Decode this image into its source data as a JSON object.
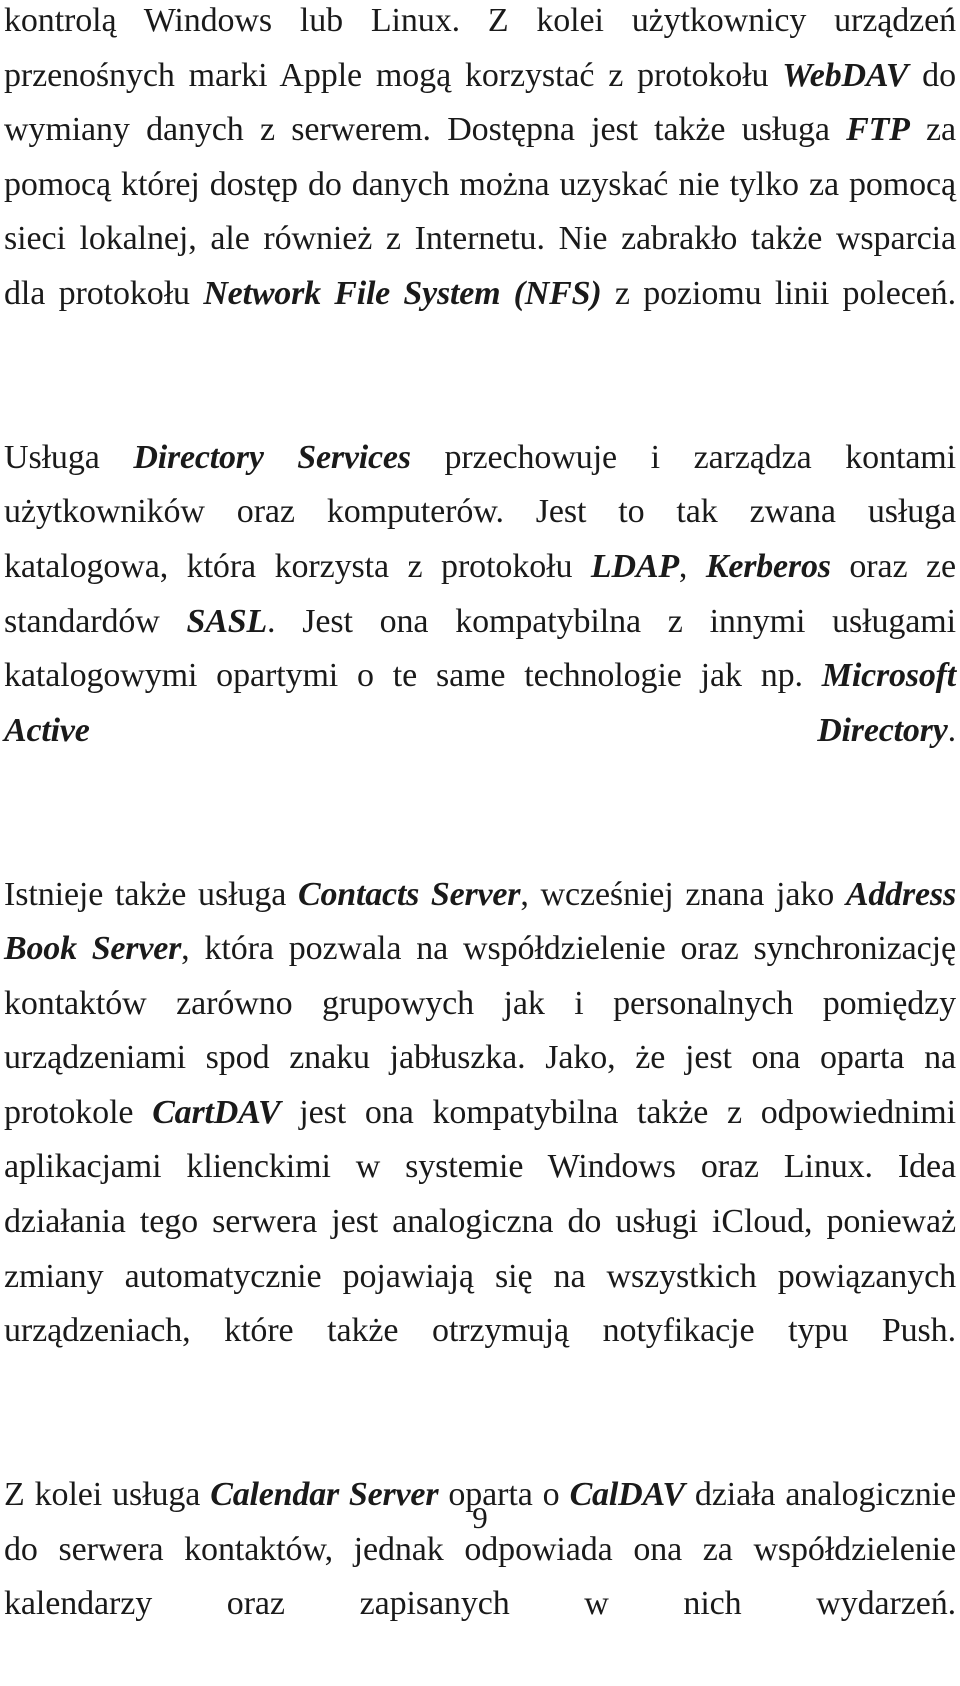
{
  "document": {
    "language": "pl",
    "page_number": "9",
    "text_color": "#1a1a1a",
    "background_color": "#ffffff",
    "paragraphs": [
      {
        "id": "paragraph-file-sharing",
        "runs": [
          {
            "text": "kontrolą Windows lub Linux. Z kolei użytkownicy urządzeń przenośnych marki Apple mogą korzystać z protokołu ",
            "emphasis": false
          },
          {
            "text": "WebDAV",
            "emphasis": true
          },
          {
            "text": " do wymiany danych z serwerem. Dostępna jest także usługa ",
            "emphasis": false
          },
          {
            "text": "FTP",
            "emphasis": true
          },
          {
            "text": " za pomocą której dostęp do danych można uzyskać nie tylko za pomocą sieci lokalnej, ale również z Internetu. Nie zabrakło także wsparcia dla protokołu ",
            "emphasis": false
          },
          {
            "text": "Network File System (NFS)",
            "emphasis": true
          },
          {
            "text": " z poziomu linii poleceń.",
            "emphasis": false
          }
        ]
      },
      {
        "id": "paragraph-directory-services",
        "runs": [
          {
            "text": "Usługa ",
            "emphasis": false
          },
          {
            "text": "Directory Services",
            "emphasis": true
          },
          {
            "text": " przechowuje i zarządza kontami użytkowników oraz komputerów. Jest to tak zwana usługa katalogowa, która korzysta z protokołu ",
            "emphasis": false
          },
          {
            "text": "LDAP",
            "emphasis": true
          },
          {
            "text": ", ",
            "emphasis": false
          },
          {
            "text": "Kerberos",
            "emphasis": true
          },
          {
            "text": " oraz ze standardów ",
            "emphasis": false
          },
          {
            "text": "SASL",
            "emphasis": true
          },
          {
            "text": ". Jest ona kompatybilna z innymi usługami katalogowymi opartymi o te same technologie jak np. ",
            "emphasis": false
          },
          {
            "text": "Microsoft Active Directory",
            "emphasis": true
          },
          {
            "text": ".",
            "emphasis": false
          }
        ]
      },
      {
        "id": "paragraph-contacts-server",
        "runs": [
          {
            "text": "Istnieje także usługa ",
            "emphasis": false
          },
          {
            "text": "Contacts Server",
            "emphasis": true
          },
          {
            "text": ", wcześniej znana jako ",
            "emphasis": false
          },
          {
            "text": "Address Book Server",
            "emphasis": true
          },
          {
            "text": ", która pozwala na współdzielenie oraz synchronizację kontaktów zarówno grupowych jak i personalnych pomiędzy urządzeniami spod znaku jabłuszka. Jako, że jest ona oparta na protokole ",
            "emphasis": false
          },
          {
            "text": "CartDAV",
            "emphasis": true
          },
          {
            "text": " jest ona kompatybilna także z odpowiednimi aplikacjami klienckimi w systemie Windows oraz Linux. Idea działania tego serwera jest analogiczna do usługi iCloud, ponieważ zmiany automatycznie pojawiają się na wszystkich powiązanych urządzeniach, które także otrzymują notyfikacje typu Push.",
            "emphasis": false
          }
        ]
      },
      {
        "id": "paragraph-calendar-server",
        "runs": [
          {
            "text": "Z kolei usługa ",
            "emphasis": false
          },
          {
            "text": "Calendar Server",
            "emphasis": true
          },
          {
            "text": " oparta o ",
            "emphasis": false
          },
          {
            "text": "CalDAV",
            "emphasis": true
          },
          {
            "text": " działa analogicznie do serwera kontaktów, jednak odpowiada ona za współdzielenie kalendarzy oraz zapisanych w nich wydarzeń.",
            "emphasis": false
          }
        ]
      }
    ]
  }
}
